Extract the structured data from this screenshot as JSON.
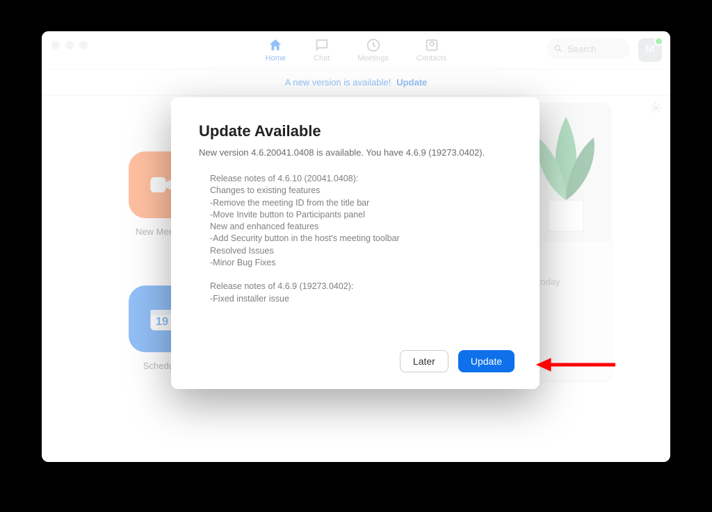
{
  "nav": {
    "tabs": [
      {
        "id": "home",
        "label": "Home",
        "active": true
      },
      {
        "id": "chat",
        "label": "Chat",
        "active": false
      },
      {
        "id": "meetings",
        "label": "Meetings",
        "active": false
      },
      {
        "id": "contacts",
        "label": "Contacts",
        "active": false
      }
    ],
    "search_placeholder": "Search",
    "avatar_initial": "M"
  },
  "banner": {
    "text": "A new version is available!",
    "link": "Update"
  },
  "tiles": {
    "new_meeting": "New Meeting",
    "schedule": "Schedule",
    "schedule_day": "19"
  },
  "right": {
    "no_events": "No upcoming meetings today"
  },
  "modal": {
    "title": "Update Available",
    "subtitle": "New version 4.6.20041.0408 is available. You have 4.6.9 (19273.0402).",
    "notes": "Release notes of 4.6.10 (20041.0408):\nChanges to existing features\n-Remove the meeting ID from the title bar\n-Move Invite button to Participants panel\nNew and enhanced features\n-Add Security button in the host's meeting toolbar\nResolved Issues\n-Minor Bug Fixes\n\nRelease notes of 4.6.9 (19273.0402):\n-Fixed installer issue",
    "later_label": "Later",
    "update_label": "Update"
  }
}
